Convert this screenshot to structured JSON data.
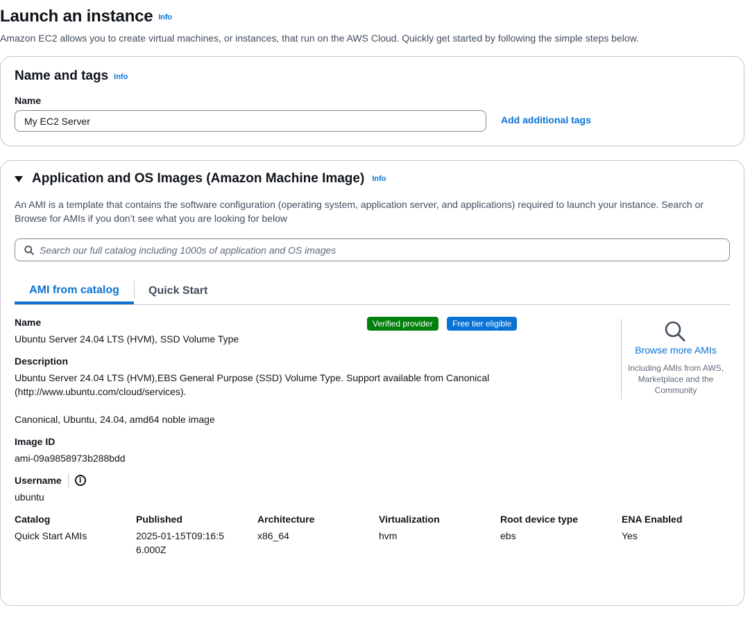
{
  "header": {
    "title": "Launch an instance",
    "info": "Info",
    "description": "Amazon EC2 allows you to create virtual machines, or instances, that run on the AWS Cloud. Quickly get started by following the simple steps below."
  },
  "name_and_tags": {
    "title": "Name and tags",
    "info": "Info",
    "name_label": "Name",
    "name_value": "My EC2 Server",
    "add_tags": "Add additional tags"
  },
  "ami": {
    "title": "Application and OS Images (Amazon Machine Image)",
    "info": "Info",
    "description": "An AMI is a template that contains the software configuration (operating system, application server, and applications) required to launch your instance. Search or Browse for AMIs if you don’t see what you are looking for below",
    "search_placeholder": "Search our full catalog including 1000s of application and OS images",
    "tabs": [
      "AMI from catalog",
      "Quick Start"
    ],
    "active_tab": "AMI from catalog",
    "badges": {
      "verified": "Verified provider",
      "free_tier": "Free tier eligible"
    },
    "browse": {
      "link": "Browse more AMIs",
      "sub": "Including AMIs from AWS, Marketplace and the Community"
    },
    "details": {
      "name_label": "Name",
      "name_value": "Ubuntu Server 24.04 LTS (HVM), SSD Volume Type",
      "desc_label": "Description",
      "desc_value_1": "Ubuntu Server 24.04 LTS (HVM),EBS General Purpose (SSD) Volume Type. Support available from Canonical",
      "desc_value_2": "(http://www.ubuntu.com/cloud/services).",
      "desc_extra": "Canonical, Ubuntu, 24.04, amd64 noble image",
      "image_id_label": "Image ID",
      "image_id_value": "ami-09a9858973b288bdd",
      "username_label": "Username",
      "username_value": "ubuntu"
    },
    "attributes": [
      {
        "label": "Catalog",
        "value": "Quick Start AMIs"
      },
      {
        "label": "Published",
        "value": "2025-01-15T09:16:56.000Z"
      },
      {
        "label": "Architecture",
        "value": "x86_64"
      },
      {
        "label": "Virtualization",
        "value": "hvm"
      },
      {
        "label": "Root device type",
        "value": "ebs"
      },
      {
        "label": "ENA Enabled",
        "value": "Yes"
      }
    ]
  },
  "colors": {
    "link": "#0972d3",
    "verified": "#037f0c",
    "free_tier": "#0972d3",
    "border": "#c6c6cd"
  }
}
